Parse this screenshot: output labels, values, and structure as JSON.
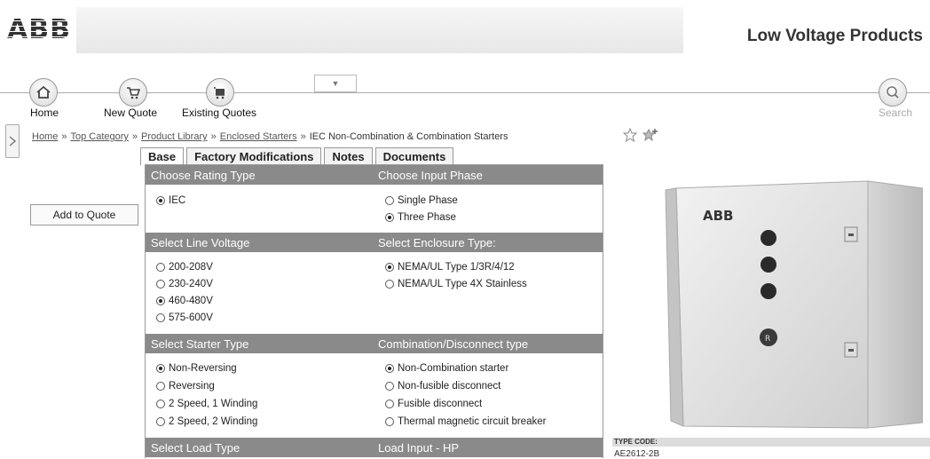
{
  "header": {
    "logo_text": "ABB",
    "title": "Low Voltage Products"
  },
  "nav": {
    "home": "Home",
    "new_quote": "New Quote",
    "existing_quotes": "Existing Quotes",
    "dropdown_glyph": "▼",
    "search": "Search"
  },
  "breadcrumb": {
    "items": [
      "Home",
      "Top Category",
      "Product Library",
      "Enclosed Starters"
    ],
    "current": "IEC Non-Combination & Combination Starters",
    "separator": "»"
  },
  "tabs": [
    "Base",
    "Factory Modifications",
    "Notes",
    "Documents"
  ],
  "add_to_quote": "Add to Quote",
  "sections": {
    "rating_type": {
      "header": "Choose Rating Type",
      "options": [
        {
          "label": "IEC",
          "selected": true
        }
      ]
    },
    "input_phase": {
      "header": "Choose Input Phase",
      "options": [
        {
          "label": "Single Phase",
          "selected": false
        },
        {
          "label": "Three Phase",
          "selected": true
        }
      ]
    },
    "line_voltage": {
      "header": "Select Line Voltage",
      "options": [
        {
          "label": "200-208V",
          "selected": false
        },
        {
          "label": "230-240V",
          "selected": false
        },
        {
          "label": "460-480V",
          "selected": true
        },
        {
          "label": "575-600V",
          "selected": false
        }
      ]
    },
    "enclosure_type": {
      "header": "Select Enclosure Type:",
      "options": [
        {
          "label": "NEMA/UL Type 1/3R/4/12",
          "selected": true
        },
        {
          "label": "NEMA/UL Type 4X Stainless",
          "selected": false
        }
      ]
    },
    "starter_type": {
      "header": "Select Starter Type",
      "options": [
        {
          "label": "Non-Reversing",
          "selected": true
        },
        {
          "label": "Reversing",
          "selected": false
        },
        {
          "label": "2 Speed, 1 Winding",
          "selected": false
        },
        {
          "label": "2 Speed, 2 Winding",
          "selected": false
        }
      ]
    },
    "combination_type": {
      "header": "Combination/Disconnect type",
      "options": [
        {
          "label": "Non-Combination starter",
          "selected": true
        },
        {
          "label": "Non-fusible disconnect",
          "selected": false
        },
        {
          "label": "Fusible disconnect",
          "selected": false
        },
        {
          "label": "Thermal magnetic circuit breaker",
          "selected": false
        }
      ]
    },
    "load_type": {
      "header": "Select Load Type"
    },
    "load_input": {
      "header": "Load Input - HP"
    }
  },
  "product": {
    "enclosure_brand": "ABB",
    "button_letter": "R"
  },
  "type_code": {
    "label": "TYPE CODE:",
    "value": "AE2612-2B"
  },
  "colors": {
    "section_header_bg": "#8a8a8a",
    "link": "#555555"
  }
}
